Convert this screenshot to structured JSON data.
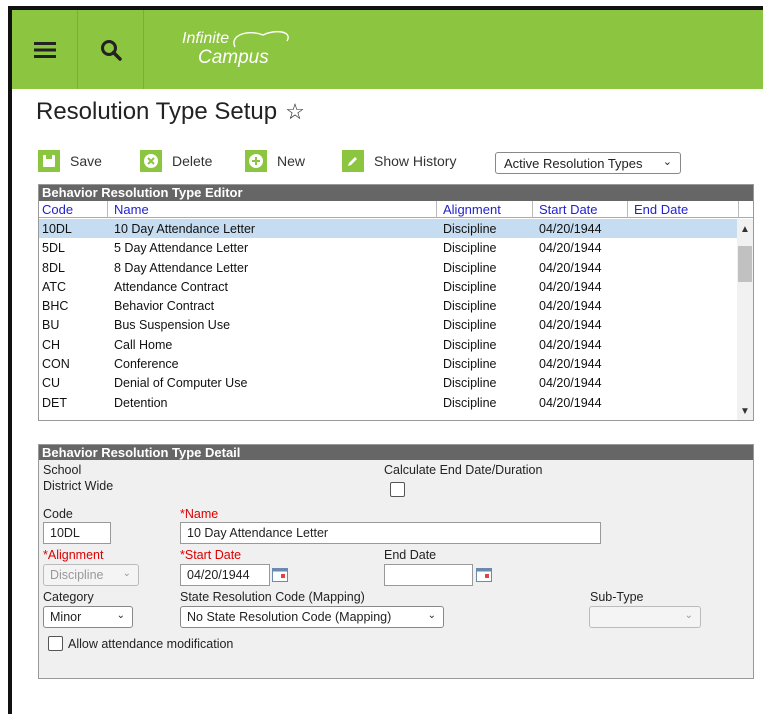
{
  "brand": {
    "line1": "Infinite",
    "line2": "Campus",
    "bar_color": "#8cc53f"
  },
  "page_title": "Resolution Type Setup",
  "toolbar": {
    "save": "Save",
    "delete": "Delete",
    "new": "New",
    "show_history": "Show History",
    "filter_selected": "Active Resolution Types"
  },
  "editor": {
    "title": "Behavior Resolution Type Editor",
    "columns": [
      "Code",
      "Name",
      "Alignment",
      "Start Date",
      "End Date"
    ],
    "rows": [
      [
        "10DL",
        "10 Day Attendance Letter",
        "Discipline",
        "04/20/1944",
        ""
      ],
      [
        "5DL",
        "5 Day Attendance Letter",
        "Discipline",
        "04/20/1944",
        ""
      ],
      [
        "8DL",
        "8 Day Attendance Letter",
        "Discipline",
        "04/20/1944",
        ""
      ],
      [
        "ATC",
        "Attendance Contract",
        "Discipline",
        "04/20/1944",
        ""
      ],
      [
        "BHC",
        "Behavior Contract",
        "Discipline",
        "04/20/1944",
        ""
      ],
      [
        "BU",
        "Bus Suspension Use",
        "Discipline",
        "04/20/1944",
        ""
      ],
      [
        "CH",
        "Call Home",
        "Discipline",
        "04/20/1944",
        ""
      ],
      [
        "CON",
        "Conference",
        "Discipline",
        "04/20/1944",
        ""
      ],
      [
        "CU",
        "Denial of Computer Use",
        "Discipline",
        "04/20/1944",
        ""
      ],
      [
        "DET",
        "Detention",
        "Discipline",
        "04/20/1944",
        ""
      ]
    ],
    "selected_row": 0
  },
  "detail": {
    "title": "Behavior Resolution Type Detail",
    "school_label": "School",
    "school_value": "District Wide",
    "calc_label": "Calculate End Date/Duration",
    "code_label": "Code",
    "code_value": "10DL",
    "name_label": "*Name",
    "name_value": "10 Day Attendance Letter",
    "alignment_label": "*Alignment",
    "alignment_value": "Discipline",
    "start_label": "*Start Date",
    "start_value": "04/20/1944",
    "end_label": "End Date",
    "end_value": "",
    "category_label": "Category",
    "category_value": "Minor",
    "state_label": "State Resolution Code (Mapping)",
    "state_value": "No State Resolution Code (Mapping)",
    "subtype_label": "Sub-Type",
    "subtype_value": "",
    "allow_label": "Allow attendance modification"
  }
}
